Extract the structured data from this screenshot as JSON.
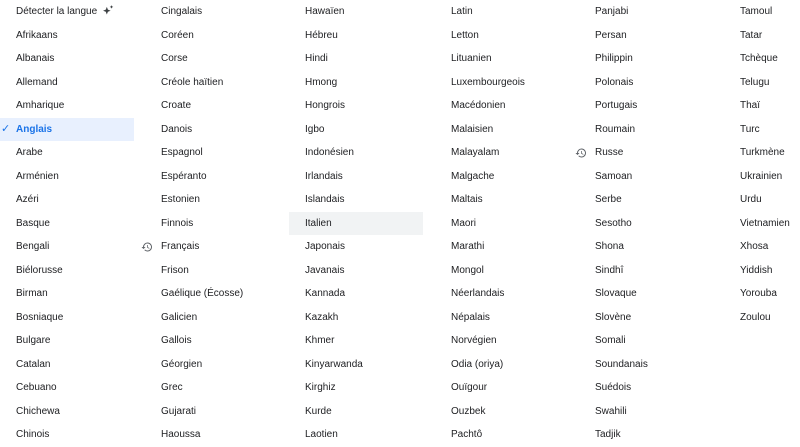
{
  "columns": [
    {
      "items": [
        {
          "label": "Détecter la langue",
          "icon": "sparkle-icon"
        },
        {
          "label": "Afrikaans"
        },
        {
          "label": "Albanais"
        },
        {
          "label": "Allemand"
        },
        {
          "label": "Amharique"
        },
        {
          "label": "Anglais",
          "selected": true
        },
        {
          "label": "Arabe"
        },
        {
          "label": "Arménien"
        },
        {
          "label": "Azéri"
        },
        {
          "label": "Basque"
        },
        {
          "label": "Bengali"
        },
        {
          "label": "Biélorusse"
        },
        {
          "label": "Birman"
        },
        {
          "label": "Bosniaque"
        },
        {
          "label": "Bulgare"
        },
        {
          "label": "Catalan"
        },
        {
          "label": "Cebuano"
        },
        {
          "label": "Chichewa"
        },
        {
          "label": "Chinois"
        }
      ]
    },
    {
      "items": [
        {
          "label": "Cingalais"
        },
        {
          "label": "Coréen"
        },
        {
          "label": "Corse"
        },
        {
          "label": "Créole haïtien"
        },
        {
          "label": "Croate"
        },
        {
          "label": "Danois"
        },
        {
          "label": "Espagnol"
        },
        {
          "label": "Espéranto"
        },
        {
          "label": "Estonien"
        },
        {
          "label": "Finnois"
        },
        {
          "label": "Français",
          "icon": "history-icon"
        },
        {
          "label": "Frison"
        },
        {
          "label": "Gaélique (Écosse)"
        },
        {
          "label": "Galicien"
        },
        {
          "label": "Gallois"
        },
        {
          "label": "Géorgien"
        },
        {
          "label": "Grec"
        },
        {
          "label": "Gujarati"
        },
        {
          "label": "Haoussa"
        }
      ]
    },
    {
      "items": [
        {
          "label": "Hawaïen"
        },
        {
          "label": "Hébreu"
        },
        {
          "label": "Hindi"
        },
        {
          "label": "Hmong"
        },
        {
          "label": "Hongrois"
        },
        {
          "label": "Igbo"
        },
        {
          "label": "Indonésien"
        },
        {
          "label": "Irlandais"
        },
        {
          "label": "Islandais"
        },
        {
          "label": "Italien",
          "hover": true
        },
        {
          "label": "Japonais"
        },
        {
          "label": "Javanais"
        },
        {
          "label": "Kannada"
        },
        {
          "label": "Kazakh"
        },
        {
          "label": "Khmer"
        },
        {
          "label": "Kinyarwanda"
        },
        {
          "label": "Kirghiz"
        },
        {
          "label": "Kurde"
        },
        {
          "label": "Laotien"
        }
      ]
    },
    {
      "items": [
        {
          "label": "Latin"
        },
        {
          "label": "Letton"
        },
        {
          "label": "Lituanien"
        },
        {
          "label": "Luxembourgeois"
        },
        {
          "label": "Macédonien"
        },
        {
          "label": "Malaisien"
        },
        {
          "label": "Malayalam"
        },
        {
          "label": "Malgache"
        },
        {
          "label": "Maltais"
        },
        {
          "label": "Maori"
        },
        {
          "label": "Marathi"
        },
        {
          "label": "Mongol"
        },
        {
          "label": "Néerlandais"
        },
        {
          "label": "Népalais"
        },
        {
          "label": "Norvégien"
        },
        {
          "label": "Odia (oriya)"
        },
        {
          "label": "Ouïgour"
        },
        {
          "label": "Ouzbek"
        },
        {
          "label": "Pachtô"
        }
      ]
    },
    {
      "items": [
        {
          "label": "Panjabi"
        },
        {
          "label": "Persan"
        },
        {
          "label": "Philippin"
        },
        {
          "label": "Polonais"
        },
        {
          "label": "Portugais"
        },
        {
          "label": "Roumain"
        },
        {
          "label": "Russe",
          "icon": "history-icon"
        },
        {
          "label": "Samoan"
        },
        {
          "label": "Serbe"
        },
        {
          "label": "Sesotho"
        },
        {
          "label": "Shona"
        },
        {
          "label": "Sindhî"
        },
        {
          "label": "Slovaque"
        },
        {
          "label": "Slovène"
        },
        {
          "label": "Somali"
        },
        {
          "label": "Soundanais"
        },
        {
          "label": "Suédois"
        },
        {
          "label": "Swahili"
        },
        {
          "label": "Tadjik"
        }
      ]
    },
    {
      "items": [
        {
          "label": "Tamoul"
        },
        {
          "label": "Tatar"
        },
        {
          "label": "Tchèque"
        },
        {
          "label": "Telugu"
        },
        {
          "label": "Thaï"
        },
        {
          "label": "Turc"
        },
        {
          "label": "Turkmène"
        },
        {
          "label": "Ukrainien"
        },
        {
          "label": "Urdu"
        },
        {
          "label": "Vietnamien"
        },
        {
          "label": "Xhosa"
        },
        {
          "label": "Yiddish"
        },
        {
          "label": "Yorouba"
        },
        {
          "label": "Zoulou"
        }
      ]
    }
  ],
  "colors": {
    "accent": "#1a73e8",
    "selected_bg": "#e8f0fe",
    "hover_bg": "#f1f3f4",
    "text": "#202124"
  }
}
